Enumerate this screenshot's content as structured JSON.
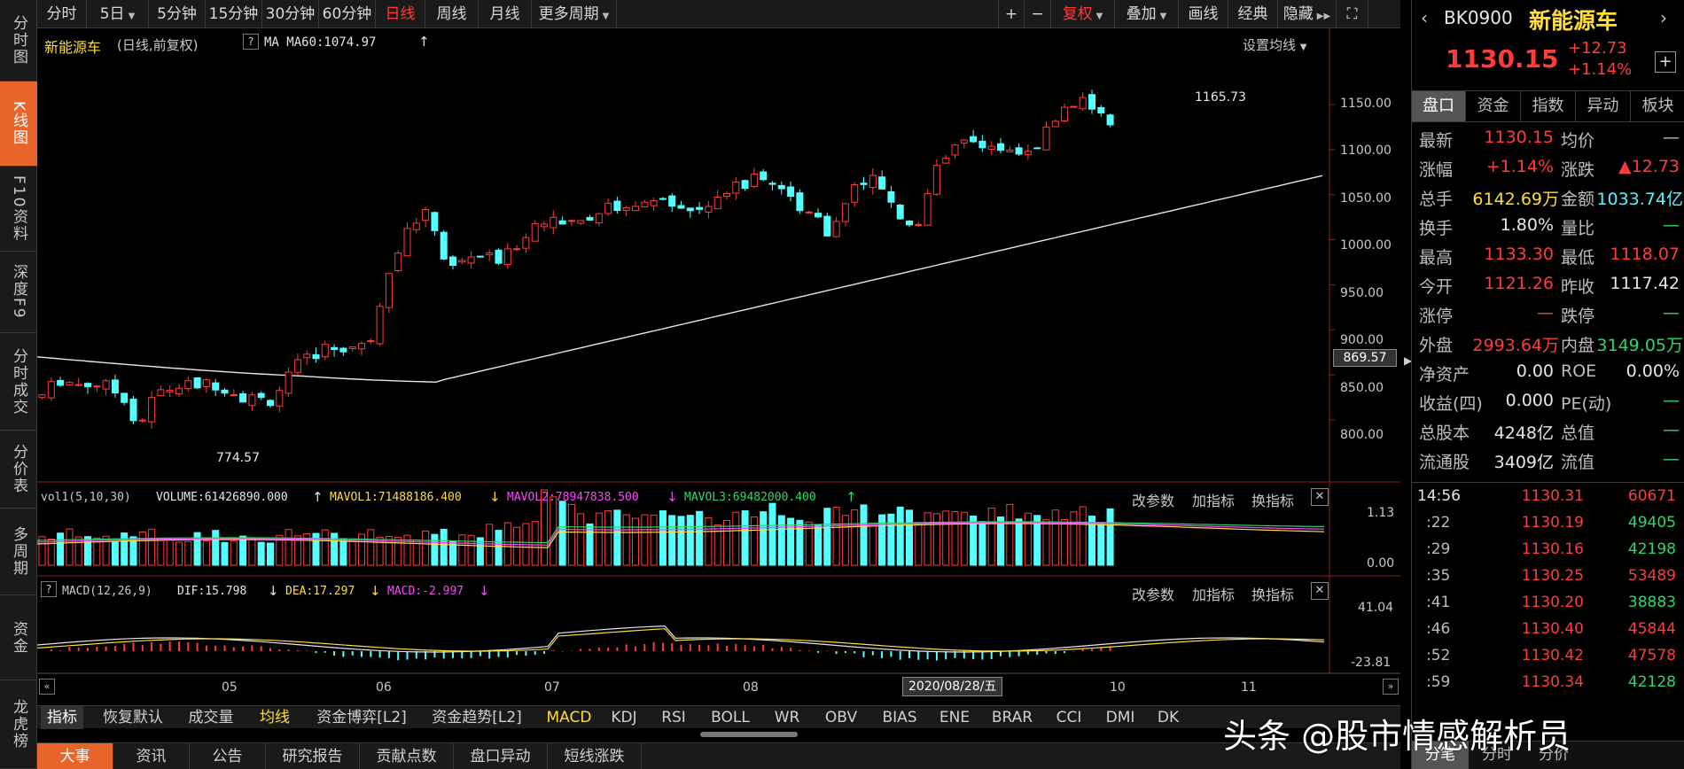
{
  "left_tabs": [
    "分时图",
    "K线图",
    "F10资料",
    "深度F9",
    "分时成交",
    "分价表",
    "多周期",
    "资金",
    "龙虎榜"
  ],
  "toolbar": {
    "periods": [
      "分时",
      "5日",
      "5分钟",
      "15分钟",
      "30分钟",
      "60分钟",
      "日线",
      "周线",
      "月线",
      "更多周期"
    ],
    "right_buttons": [
      "+",
      "−",
      "复权",
      "叠加",
      "画线",
      "经典",
      "隐藏"
    ],
    "active_period": "日线"
  },
  "chart": {
    "title": "新能源车",
    "subtitle": "(日线,前复权)",
    "ma_label": "MA  MA60:1074.97",
    "set_ma": "设置均线",
    "price_ticks": [
      "1150.00",
      "1100.00",
      "1050.00",
      "1000.00",
      "950.00",
      "900.00",
      "850.00",
      "800.00"
    ],
    "cursor_price": "869.57",
    "high_label": "1165.73",
    "low_label": "774.57",
    "vol_line": "vol1(5,10,30)",
    "vol_volume": "VOLUME:61426890.000",
    "mavol1": "MAVOL1:71488186.400",
    "mavol2": "MAVOL2:78947838.500",
    "mavol3": "MAVOL3:69482000.400",
    "vol_ticks": [
      "1.13",
      "0.00"
    ],
    "macd_line": "MACD(12,26,9)",
    "dif": "DIF:15.798",
    "dea": "DEA:17.297",
    "macd": "MACD:-2.997",
    "macd_ticks": [
      "41.04",
      "-23.81"
    ],
    "panel_buttons": [
      "改参数",
      "加指标",
      "换指标"
    ],
    "months": [
      "05",
      "06",
      "07",
      "08",
      "10",
      "11"
    ],
    "cursor_date": "2020/08/28/五"
  },
  "indicator_tabs": [
    "指标",
    "恢复默认",
    "成交量",
    "均线",
    "资金博弈[L2]",
    "资金趋势[L2]",
    "MACD",
    "KDJ",
    "RSI",
    "BOLL",
    "WR",
    "OBV",
    "BIAS",
    "ENE",
    "BRAR",
    "CCI",
    "DMI",
    "DK"
  ],
  "bottom_tabs": [
    "大事",
    "资讯",
    "公告",
    "研究报告",
    "贡献点数",
    "盘口异动",
    "短线涨跌"
  ],
  "quote": {
    "code": "BK0900",
    "name": "新能源车",
    "price": "1130.15",
    "change": "+12.73",
    "change_pct": "+1.14%",
    "tabs": [
      "盘口",
      "资金",
      "指数",
      "异动",
      "板块"
    ],
    "rows": [
      {
        "l1": "最新",
        "v1": "1130.15",
        "l2": "均价",
        "v2": "—"
      },
      {
        "l1": "涨幅",
        "v1": "+1.14%",
        "l2": "涨跌",
        "v2": "▲12.73"
      },
      {
        "l1": "总手",
        "v1": "6142.69万",
        "l2": "金额",
        "v2": "1033.74亿"
      },
      {
        "l1": "换手",
        "v1": "1.80%",
        "l2": "量比",
        "v2": "—"
      },
      {
        "l1": "最高",
        "v1": "1133.30",
        "l2": "最低",
        "v2": "1118.07"
      },
      {
        "l1": "今开",
        "v1": "1121.26",
        "l2": "昨收",
        "v2": "1117.42"
      },
      {
        "l1": "涨停",
        "v1": "—",
        "l2": "跌停",
        "v2": "—"
      },
      {
        "l1": "外盘",
        "v1": "2993.64万",
        "l2": "内盘",
        "v2": "3149.05万"
      },
      {
        "l1": "净资产",
        "v1": "0.00",
        "l2": "ROE",
        "v2": "0.00%"
      },
      {
        "l1": "收益(四)",
        "v1": "0.000",
        "l2": "PE(动)",
        "v2": "—"
      },
      {
        "l1": "总股本",
        "v1": "4248亿",
        "l2": "总值",
        "v2": "—"
      },
      {
        "l1": "流通股",
        "v1": "3409亿",
        "l2": "流值",
        "v2": "—"
      }
    ],
    "ticks": [
      {
        "time": "14:56",
        "price": "1130.31",
        "vol": "60671"
      },
      {
        "time": ":22",
        "price": "1130.19",
        "vol": "49405"
      },
      {
        "time": ":29",
        "price": "1130.16",
        "vol": "42198"
      },
      {
        "time": ":35",
        "price": "1130.25",
        "vol": "53489"
      },
      {
        "time": ":41",
        "price": "1130.20",
        "vol": "38883"
      },
      {
        "time": ":46",
        "price": "1130.40",
        "vol": "45844"
      },
      {
        "time": ":52",
        "price": "1130.42",
        "vol": "47578"
      },
      {
        "time": ":59",
        "price": "1130.34",
        "vol": "42128"
      }
    ],
    "bottom_tabs": [
      "分笔",
      "分时",
      "分价"
    ]
  },
  "watermark": "头条 @股市情感解析员"
}
